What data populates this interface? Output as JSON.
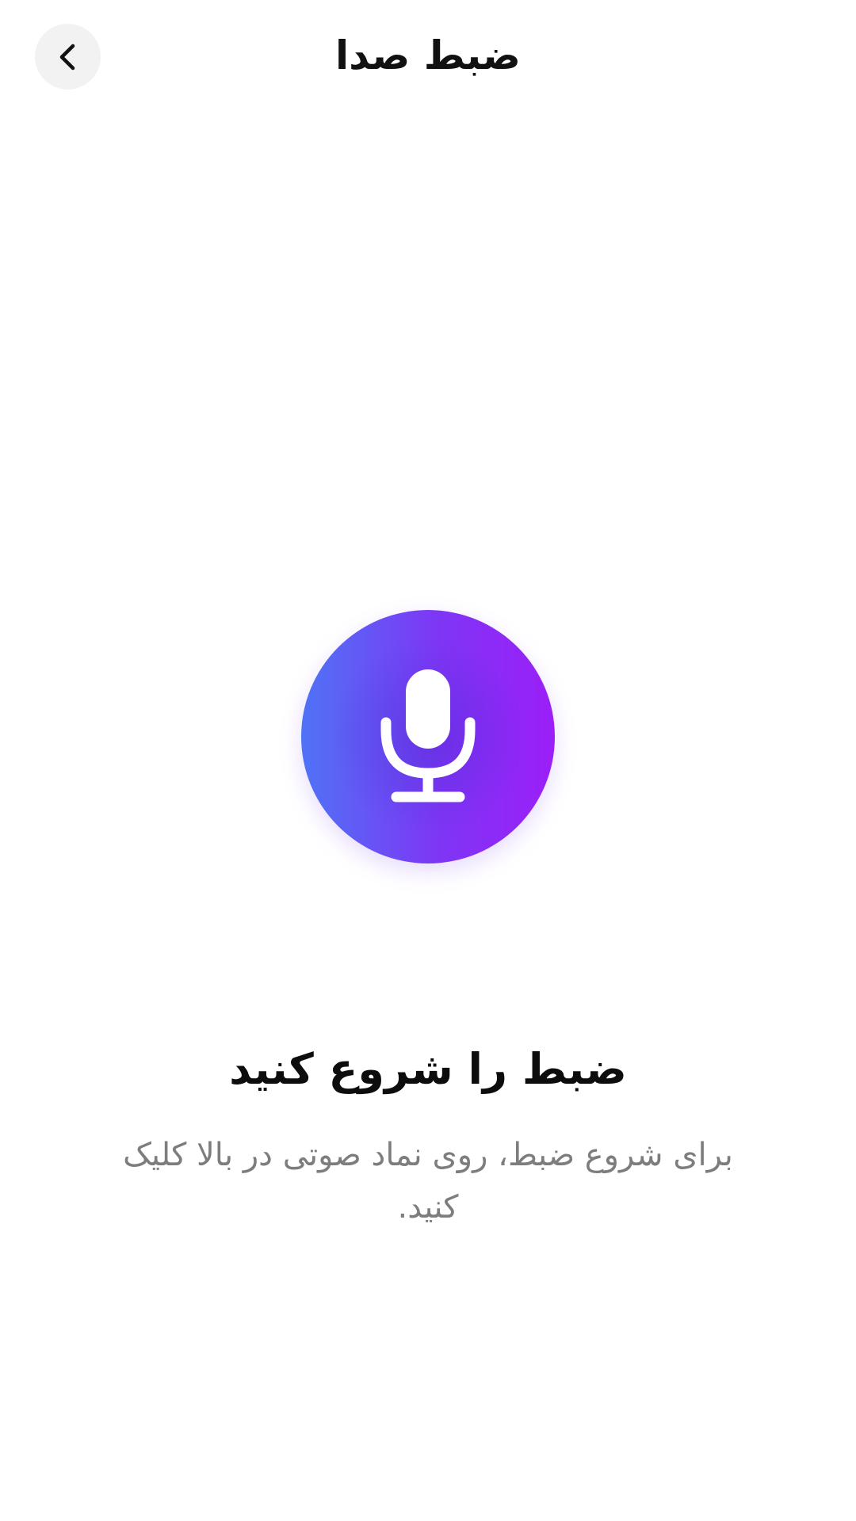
{
  "header": {
    "title": "ضبط صدا",
    "back_icon": "chevron-left-icon"
  },
  "record_button": {
    "icon": "microphone-icon",
    "gradient_colors": [
      "#4f73f6",
      "#7f35f5",
      "#9b1ff8"
    ]
  },
  "content": {
    "headline": "ضبط را شروع کنید",
    "hint": "برای شروع ضبط، روی نماد صوتی در بالا کلیک کنید."
  }
}
